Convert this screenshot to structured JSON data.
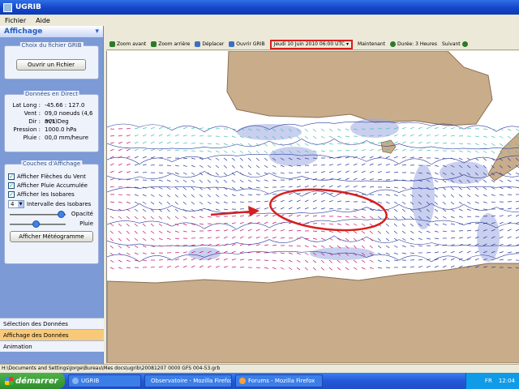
{
  "window": {
    "title": "UGRIB"
  },
  "menu": [
    "Fichier",
    "Aide"
  ],
  "panel": {
    "title": "Affichage",
    "grib_file": {
      "group_title": "Choix du fichier GRIB",
      "open_button": "Ouvrir un Fichier"
    },
    "direct_data": {
      "group_title": "Données en Direct",
      "rows": [
        {
          "label": "Lat Long :",
          "value": "-45.66 : 127.0"
        },
        {
          "label": "Vent :",
          "value": "09,0 noeuds (4,6 m/s)"
        },
        {
          "label": "Dir :",
          "value": "301 Deg"
        },
        {
          "label": "Pression :",
          "value": "1000.0 hPa"
        },
        {
          "label": "Pluie :",
          "value": "00,0 mm/heure"
        }
      ]
    },
    "layers": {
      "group_title": "Couches d'Affichage",
      "checks": [
        "Afficher Flèches du Vent",
        "Afficher Pluie Accumulée",
        "Afficher les Isobares"
      ],
      "isobar_interval": "4",
      "isobar_label": "Intervalle des Isobares",
      "slider_1": {
        "label": "Opacité",
        "level": 0.95
      },
      "slider_2": {
        "label": "Pluie",
        "level": 0.45
      },
      "meteogram_button": "Afficher Météogramme"
    },
    "tabs": [
      {
        "label": "Sélection des Données",
        "active": false
      },
      {
        "label": "Affichage des Données",
        "active": true
      },
      {
        "label": "Animation",
        "active": false
      }
    ]
  },
  "toolbar": {
    "items": [
      {
        "label": "Zoom avant",
        "color": "#2a7a2a"
      },
      {
        "label": "Zoom arrière",
        "color": "#2a7a2a"
      },
      {
        "label": "Déplacer",
        "color": "#3d6fbf"
      },
      {
        "label": "Ouvrir GRIB",
        "color": "#3d6fbf"
      }
    ],
    "time_selector": "Jeudi 10 Juin 2010 06:00 UTC",
    "right_items": [
      {
        "label": "Maintenant",
        "color": "#2a7a2a"
      },
      {
        "label": "Durée: 3 Heures",
        "color": "#2a7a2a"
      },
      {
        "label": "Suivant",
        "color": "#2a7a2a"
      }
    ]
  },
  "statusbar": {
    "path": "H:\\Documents and Settings\\Jorge\\Bureau\\Mes docs\\ugrib\\20081207 0000 GFS 004-53.grb"
  },
  "taskbar": {
    "start": "démarrer",
    "tasks": [
      "UGRIB",
      "Observatoire - Mozilla Firefox",
      "Forums - Mozilla Firefox"
    ],
    "tray": {
      "lang": "FR",
      "time": "12:04"
    }
  },
  "colors": {
    "land": "#c9ad8b",
    "sea": "#ffffff",
    "rain": "#9ca8e0",
    "isobar": "#2b3c9c",
    "highlight": "#d61f1f",
    "wind_strong": "#c2146e",
    "wind_light": "#46c0b3"
  }
}
